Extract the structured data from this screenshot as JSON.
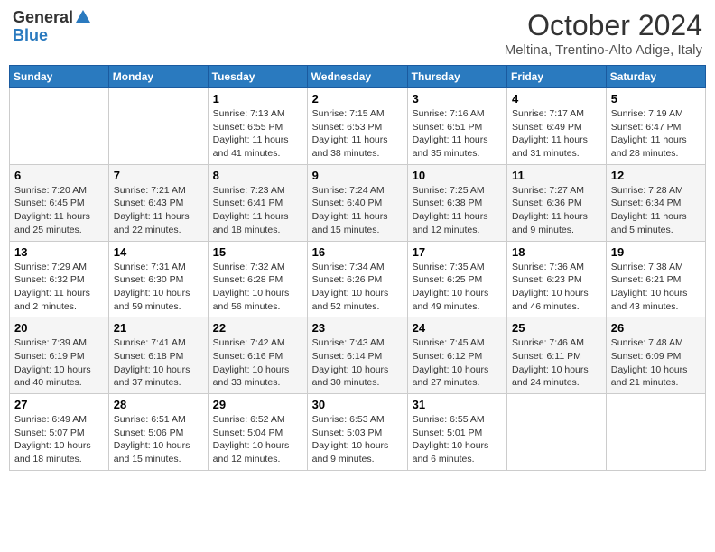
{
  "header": {
    "logo_general": "General",
    "logo_blue": "Blue",
    "month": "October 2024",
    "location": "Meltina, Trentino-Alto Adige, Italy"
  },
  "days_of_week": [
    "Sunday",
    "Monday",
    "Tuesday",
    "Wednesday",
    "Thursday",
    "Friday",
    "Saturday"
  ],
  "weeks": [
    [
      {
        "day": "",
        "info": ""
      },
      {
        "day": "",
        "info": ""
      },
      {
        "day": "1",
        "info": "Sunrise: 7:13 AM\nSunset: 6:55 PM\nDaylight: 11 hours and 41 minutes."
      },
      {
        "day": "2",
        "info": "Sunrise: 7:15 AM\nSunset: 6:53 PM\nDaylight: 11 hours and 38 minutes."
      },
      {
        "day": "3",
        "info": "Sunrise: 7:16 AM\nSunset: 6:51 PM\nDaylight: 11 hours and 35 minutes."
      },
      {
        "day": "4",
        "info": "Sunrise: 7:17 AM\nSunset: 6:49 PM\nDaylight: 11 hours and 31 minutes."
      },
      {
        "day": "5",
        "info": "Sunrise: 7:19 AM\nSunset: 6:47 PM\nDaylight: 11 hours and 28 minutes."
      }
    ],
    [
      {
        "day": "6",
        "info": "Sunrise: 7:20 AM\nSunset: 6:45 PM\nDaylight: 11 hours and 25 minutes."
      },
      {
        "day": "7",
        "info": "Sunrise: 7:21 AM\nSunset: 6:43 PM\nDaylight: 11 hours and 22 minutes."
      },
      {
        "day": "8",
        "info": "Sunrise: 7:23 AM\nSunset: 6:41 PM\nDaylight: 11 hours and 18 minutes."
      },
      {
        "day": "9",
        "info": "Sunrise: 7:24 AM\nSunset: 6:40 PM\nDaylight: 11 hours and 15 minutes."
      },
      {
        "day": "10",
        "info": "Sunrise: 7:25 AM\nSunset: 6:38 PM\nDaylight: 11 hours and 12 minutes."
      },
      {
        "day": "11",
        "info": "Sunrise: 7:27 AM\nSunset: 6:36 PM\nDaylight: 11 hours and 9 minutes."
      },
      {
        "day": "12",
        "info": "Sunrise: 7:28 AM\nSunset: 6:34 PM\nDaylight: 11 hours and 5 minutes."
      }
    ],
    [
      {
        "day": "13",
        "info": "Sunrise: 7:29 AM\nSunset: 6:32 PM\nDaylight: 11 hours and 2 minutes."
      },
      {
        "day": "14",
        "info": "Sunrise: 7:31 AM\nSunset: 6:30 PM\nDaylight: 10 hours and 59 minutes."
      },
      {
        "day": "15",
        "info": "Sunrise: 7:32 AM\nSunset: 6:28 PM\nDaylight: 10 hours and 56 minutes."
      },
      {
        "day": "16",
        "info": "Sunrise: 7:34 AM\nSunset: 6:26 PM\nDaylight: 10 hours and 52 minutes."
      },
      {
        "day": "17",
        "info": "Sunrise: 7:35 AM\nSunset: 6:25 PM\nDaylight: 10 hours and 49 minutes."
      },
      {
        "day": "18",
        "info": "Sunrise: 7:36 AM\nSunset: 6:23 PM\nDaylight: 10 hours and 46 minutes."
      },
      {
        "day": "19",
        "info": "Sunrise: 7:38 AM\nSunset: 6:21 PM\nDaylight: 10 hours and 43 minutes."
      }
    ],
    [
      {
        "day": "20",
        "info": "Sunrise: 7:39 AM\nSunset: 6:19 PM\nDaylight: 10 hours and 40 minutes."
      },
      {
        "day": "21",
        "info": "Sunrise: 7:41 AM\nSunset: 6:18 PM\nDaylight: 10 hours and 37 minutes."
      },
      {
        "day": "22",
        "info": "Sunrise: 7:42 AM\nSunset: 6:16 PM\nDaylight: 10 hours and 33 minutes."
      },
      {
        "day": "23",
        "info": "Sunrise: 7:43 AM\nSunset: 6:14 PM\nDaylight: 10 hours and 30 minutes."
      },
      {
        "day": "24",
        "info": "Sunrise: 7:45 AM\nSunset: 6:12 PM\nDaylight: 10 hours and 27 minutes."
      },
      {
        "day": "25",
        "info": "Sunrise: 7:46 AM\nSunset: 6:11 PM\nDaylight: 10 hours and 24 minutes."
      },
      {
        "day": "26",
        "info": "Sunrise: 7:48 AM\nSunset: 6:09 PM\nDaylight: 10 hours and 21 minutes."
      }
    ],
    [
      {
        "day": "27",
        "info": "Sunrise: 6:49 AM\nSunset: 5:07 PM\nDaylight: 10 hours and 18 minutes."
      },
      {
        "day": "28",
        "info": "Sunrise: 6:51 AM\nSunset: 5:06 PM\nDaylight: 10 hours and 15 minutes."
      },
      {
        "day": "29",
        "info": "Sunrise: 6:52 AM\nSunset: 5:04 PM\nDaylight: 10 hours and 12 minutes."
      },
      {
        "day": "30",
        "info": "Sunrise: 6:53 AM\nSunset: 5:03 PM\nDaylight: 10 hours and 9 minutes."
      },
      {
        "day": "31",
        "info": "Sunrise: 6:55 AM\nSunset: 5:01 PM\nDaylight: 10 hours and 6 minutes."
      },
      {
        "day": "",
        "info": ""
      },
      {
        "day": "",
        "info": ""
      }
    ]
  ]
}
